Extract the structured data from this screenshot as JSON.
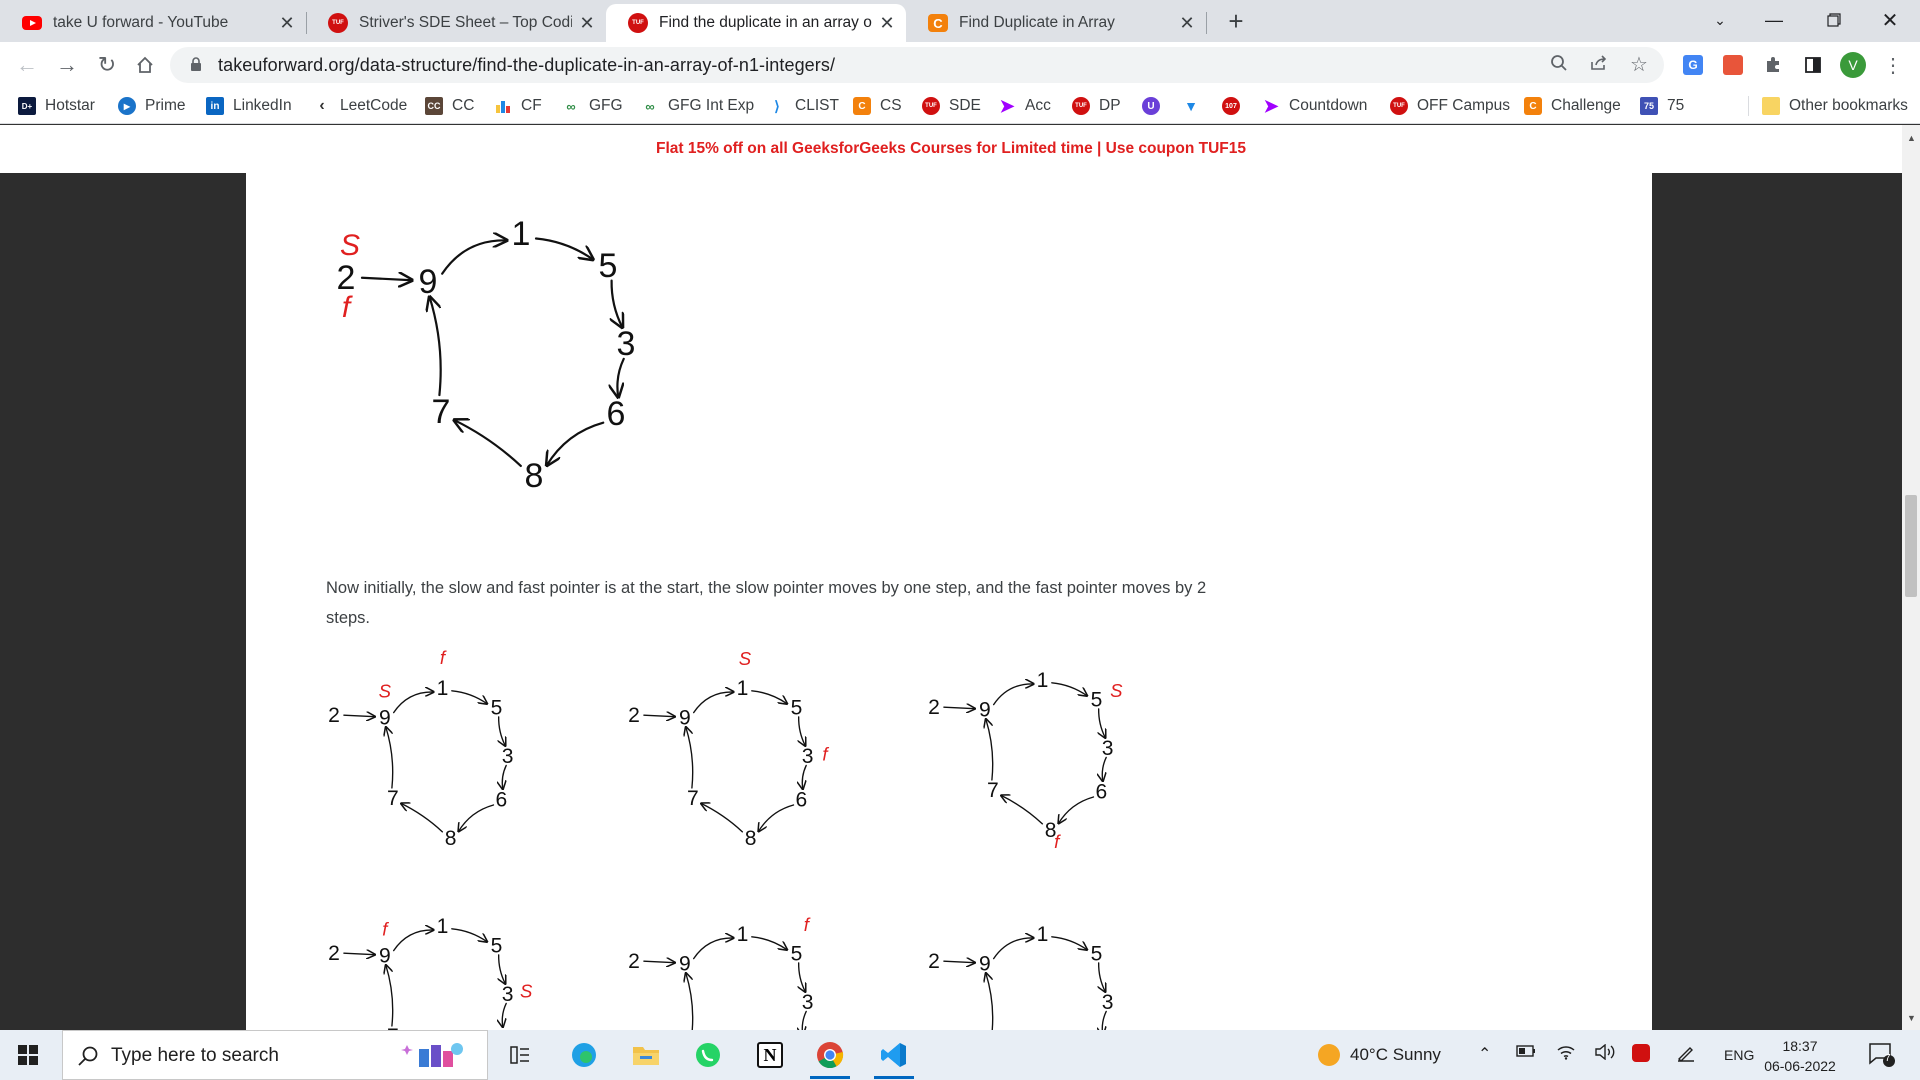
{
  "tabs": [
    {
      "title": "take U forward - YouTube",
      "icon": "youtube-icon"
    },
    {
      "title": "Striver's SDE Sheet – Top Coding",
      "icon": "tuf-icon"
    },
    {
      "title": "Find the duplicate in an array of N",
      "icon": "tuf-icon"
    },
    {
      "title": "Find Duplicate in Array",
      "icon": "codingninjas-icon"
    }
  ],
  "address_bar": {
    "url": "takeuforward.org/data-structure/find-the-duplicate-in-an-array-of-n1-integers/"
  },
  "profile_initial": "V",
  "bookmarks": [
    {
      "label": "Hotstar"
    },
    {
      "label": "Prime"
    },
    {
      "label": "LinkedIn"
    },
    {
      "label": "LeetCode"
    },
    {
      "label": "CC"
    },
    {
      "label": "CF"
    },
    {
      "label": "GFG"
    },
    {
      "label": "GFG Int Exp"
    },
    {
      "label": "CLIST"
    },
    {
      "label": "CS"
    },
    {
      "label": "SDE"
    },
    {
      "label": "Acc"
    },
    {
      "label": "DP"
    },
    {
      "label": "Countdown"
    },
    {
      "label": "OFF Campus"
    },
    {
      "label": "Challenge"
    },
    {
      "label": "75"
    },
    {
      "label": "Other bookmarks"
    }
  ],
  "bookmark_badges": {
    "cc": "CC",
    "seventy_five": "75",
    "notif": "107"
  },
  "promo": "Flat 15% off on all GeeksforGeeks Courses for Limited time | Use coupon TUF15",
  "article": {
    "paragraph": "Now initially, the slow and fast pointer is at the start, the slow pointer moves by one step, and the fast pointer moves by 2 steps."
  },
  "diagram": {
    "nodes": {
      "start": "2",
      "n9": "9",
      "n1": "1",
      "n5": "5",
      "n3": "3",
      "n6": "6",
      "n8": "8",
      "n7": "7"
    },
    "slow_label": "S",
    "fast_label": "f"
  },
  "taskbar": {
    "search_placeholder": "Type here to search",
    "weather": "40°C  Sunny",
    "language": "ENG",
    "time": "18:37",
    "date": "06-06-2022",
    "notification_count": "7"
  }
}
